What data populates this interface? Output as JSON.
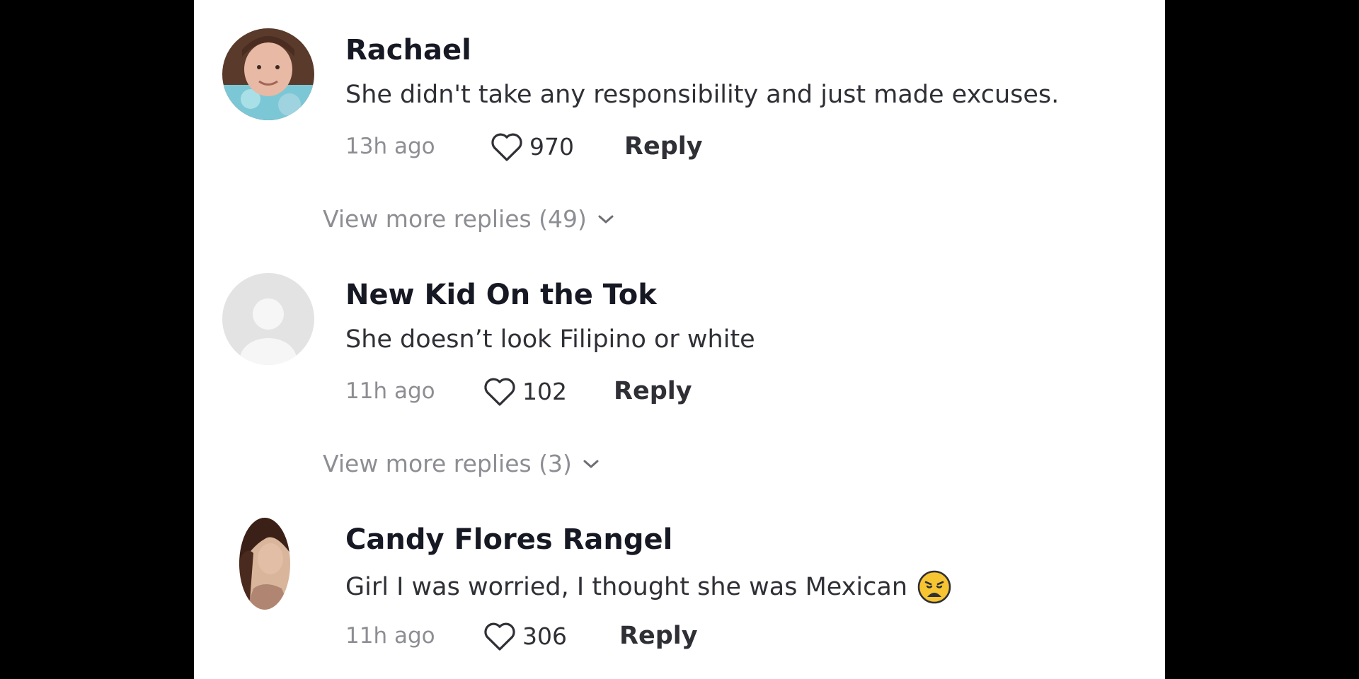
{
  "comments": [
    {
      "username": "Rachael",
      "text": "She didn't take any responsibility and just made excuses.",
      "time": "13h ago",
      "likes": "970",
      "reply_label": "Reply",
      "view_more": "View more replies (49)"
    },
    {
      "username": "New Kid On the Tok",
      "text": "She doesn’t look Filipino or white",
      "time": "11h ago",
      "likes": "102",
      "reply_label": "Reply",
      "view_more": "View more replies (3)"
    },
    {
      "username": "Candy Flores Rangel",
      "text": "Girl I was worried, I thought she was Mexican",
      "emoji": "weary-face-emoji",
      "time": "11h ago",
      "likes": "306",
      "reply_label": "Reply"
    }
  ],
  "icons": {
    "like": "heart-outline-icon",
    "expand": "chevron-down-icon",
    "default_avatar": "default-avatar-icon"
  },
  "colors": {
    "background": "#000000",
    "panel": "#ffffff",
    "username": "#161823",
    "text": "#2f3036",
    "muted": "#8d8e93"
  }
}
